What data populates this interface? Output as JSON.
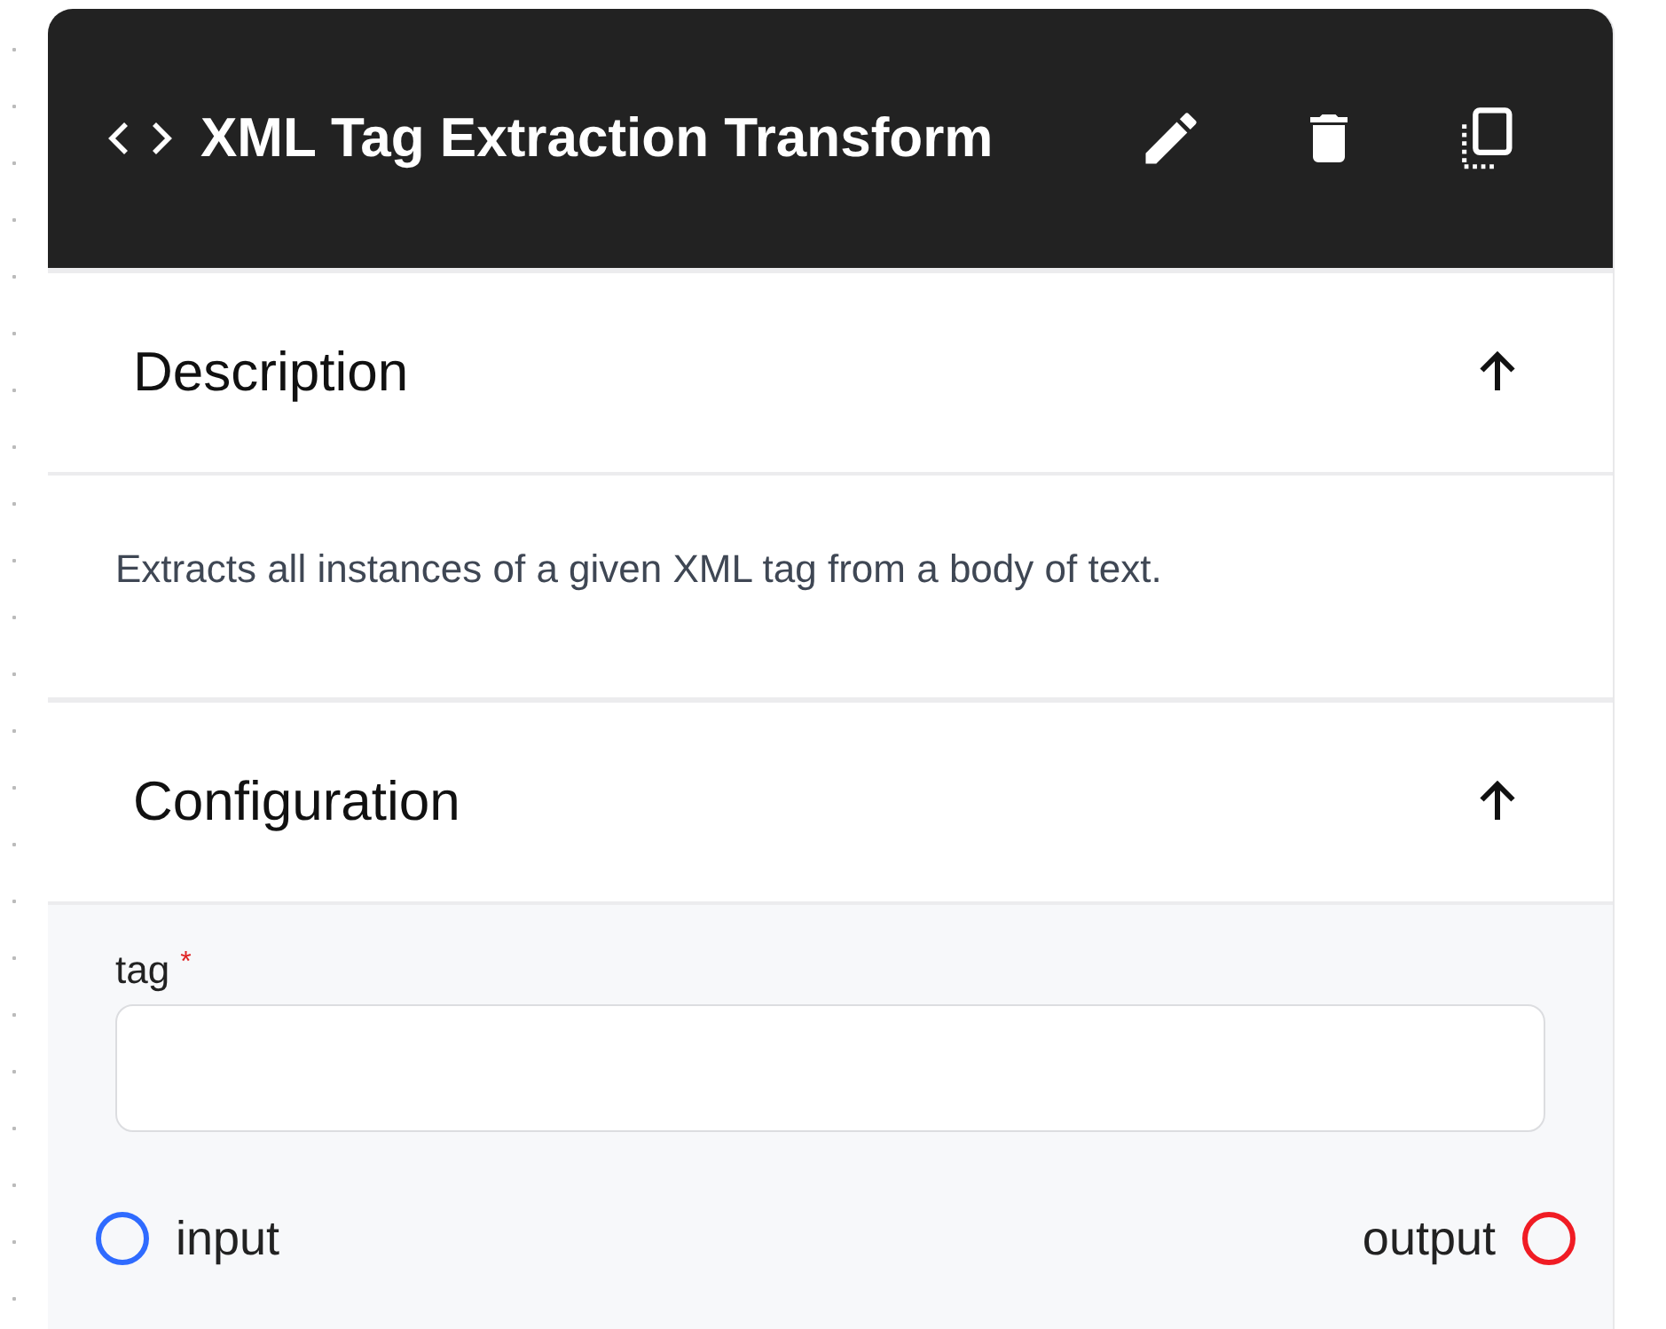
{
  "node": {
    "title": "XML Tag Extraction Transform"
  },
  "description": {
    "title": "Description",
    "expanded": true,
    "text": "Extracts all instances of a given XML tag from a body of text."
  },
  "configuration": {
    "title": "Configuration",
    "expanded": true,
    "fields": [
      {
        "label": "tag",
        "required": true,
        "required_mark": "*"
      }
    ]
  },
  "ports": [
    {
      "kind": "input",
      "label": "input",
      "color": "#2f6bff"
    },
    {
      "kind": "output",
      "label": "output",
      "color": "#f01c24"
    }
  ]
}
